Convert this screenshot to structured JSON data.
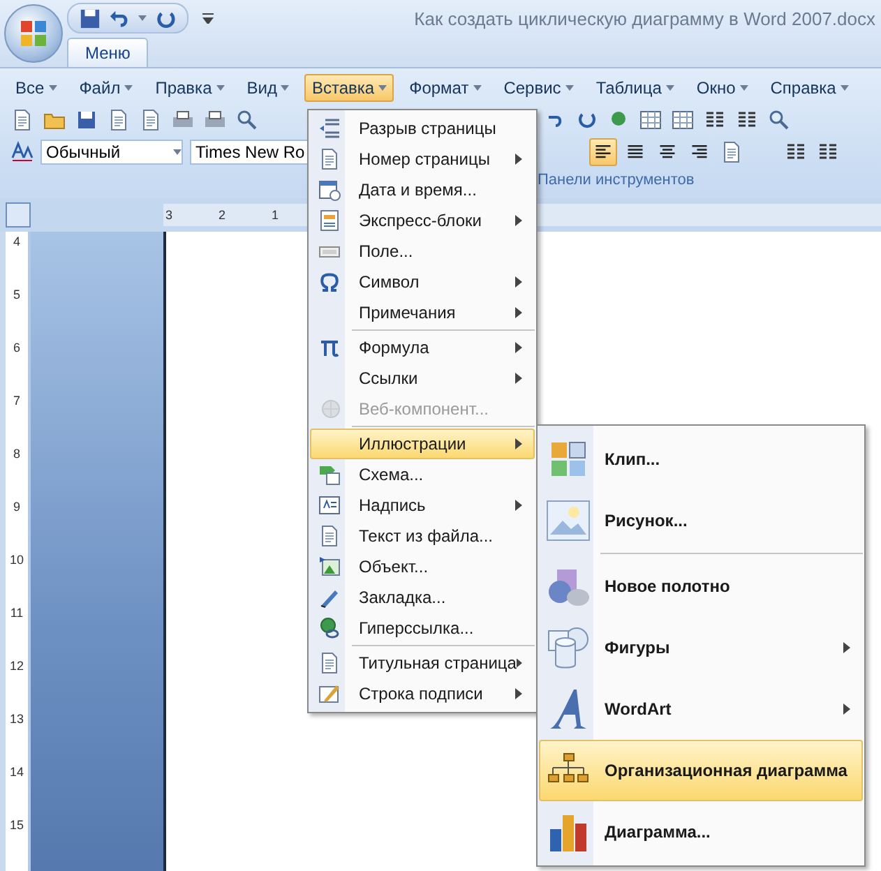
{
  "window": {
    "title": "Как создать циклическую диаграмму в Word 2007.docx"
  },
  "ribbon_tabs": [
    {
      "label": "Меню",
      "selected": true
    }
  ],
  "menu_bar": [
    {
      "label": "Все",
      "selected": false
    },
    {
      "label": "Файл",
      "selected": false
    },
    {
      "label": "Правка",
      "selected": false
    },
    {
      "label": "Вид",
      "selected": false
    },
    {
      "label": "Вставка",
      "selected": true
    },
    {
      "label": "Формат",
      "selected": false
    },
    {
      "label": "Сервис",
      "selected": false
    },
    {
      "label": "Таблица",
      "selected": false
    },
    {
      "label": "Окно",
      "selected": false
    },
    {
      "label": "Справка",
      "selected": false
    }
  ],
  "formatting": {
    "style": "Обычный",
    "font": "Times New Ro",
    "group_label": "Панели инструментов"
  },
  "alignment_buttons": [
    {
      "selected": true
    },
    {
      "selected": false
    },
    {
      "selected": false
    },
    {
      "selected": false
    }
  ],
  "rulers": {
    "horizontal": [
      "3",
      "2",
      "1"
    ],
    "vertical": [
      "4",
      "5",
      "6",
      "7",
      "8",
      "9",
      "10",
      "11",
      "12",
      "13",
      "14",
      "15"
    ]
  },
  "insert_menu": [
    {
      "kind": "item",
      "label": "Разрыв страницы",
      "submenu": false,
      "disabled": false,
      "selected": false
    },
    {
      "kind": "item",
      "label": "Номер страницы",
      "submenu": true,
      "disabled": false,
      "selected": false
    },
    {
      "kind": "item",
      "label": "Дата и время...",
      "submenu": false,
      "disabled": false,
      "selected": false
    },
    {
      "kind": "item",
      "label": "Экспресс-блоки",
      "submenu": true,
      "disabled": false,
      "selected": false
    },
    {
      "kind": "item",
      "label": "Поле...",
      "submenu": false,
      "disabled": false,
      "selected": false
    },
    {
      "kind": "item",
      "label": "Символ",
      "submenu": true,
      "disabled": false,
      "selected": false
    },
    {
      "kind": "item",
      "label": "Примечания",
      "submenu": true,
      "disabled": false,
      "selected": false
    },
    {
      "kind": "separator"
    },
    {
      "kind": "item",
      "label": "Формула",
      "submenu": true,
      "disabled": false,
      "selected": false
    },
    {
      "kind": "item",
      "label": "Ссылки",
      "submenu": true,
      "disabled": false,
      "selected": false
    },
    {
      "kind": "item",
      "label": "Веб-компонент...",
      "submenu": false,
      "disabled": true,
      "selected": false
    },
    {
      "kind": "separator"
    },
    {
      "kind": "item",
      "label": "Иллюстрации",
      "submenu": true,
      "disabled": false,
      "selected": true
    },
    {
      "kind": "item",
      "label": "Схема...",
      "submenu": false,
      "disabled": false,
      "selected": false
    },
    {
      "kind": "item",
      "label": "Надпись",
      "submenu": true,
      "disabled": false,
      "selected": false
    },
    {
      "kind": "item",
      "label": "Текст из файла...",
      "submenu": false,
      "disabled": false,
      "selected": false
    },
    {
      "kind": "item",
      "label": "Объект...",
      "submenu": false,
      "disabled": false,
      "selected": false
    },
    {
      "kind": "item",
      "label": "Закладка...",
      "submenu": false,
      "disabled": false,
      "selected": false
    },
    {
      "kind": "item",
      "label": "Гиперссылка...",
      "submenu": false,
      "disabled": false,
      "selected": false
    },
    {
      "kind": "separator"
    },
    {
      "kind": "item",
      "label": "Титульная страница",
      "submenu": true,
      "disabled": false,
      "selected": false
    },
    {
      "kind": "item",
      "label": "Строка подписи",
      "submenu": true,
      "disabled": false,
      "selected": false
    }
  ],
  "illustrations_menu": [
    {
      "kind": "item",
      "label": "Клип...",
      "submenu": false,
      "selected": false
    },
    {
      "kind": "item",
      "label": "Рисунок...",
      "submenu": false,
      "selected": false
    },
    {
      "kind": "separator"
    },
    {
      "kind": "item",
      "label": "Новое полотно",
      "submenu": false,
      "selected": false
    },
    {
      "kind": "item",
      "label": "Фигуры",
      "submenu": true,
      "selected": false
    },
    {
      "kind": "item",
      "label": "WordArt",
      "submenu": true,
      "selected": false
    },
    {
      "kind": "item",
      "label": "Организационная диаграмма",
      "submenu": false,
      "selected": true
    },
    {
      "kind": "item",
      "label": "Диаграмма...",
      "submenu": false,
      "selected": false
    }
  ]
}
